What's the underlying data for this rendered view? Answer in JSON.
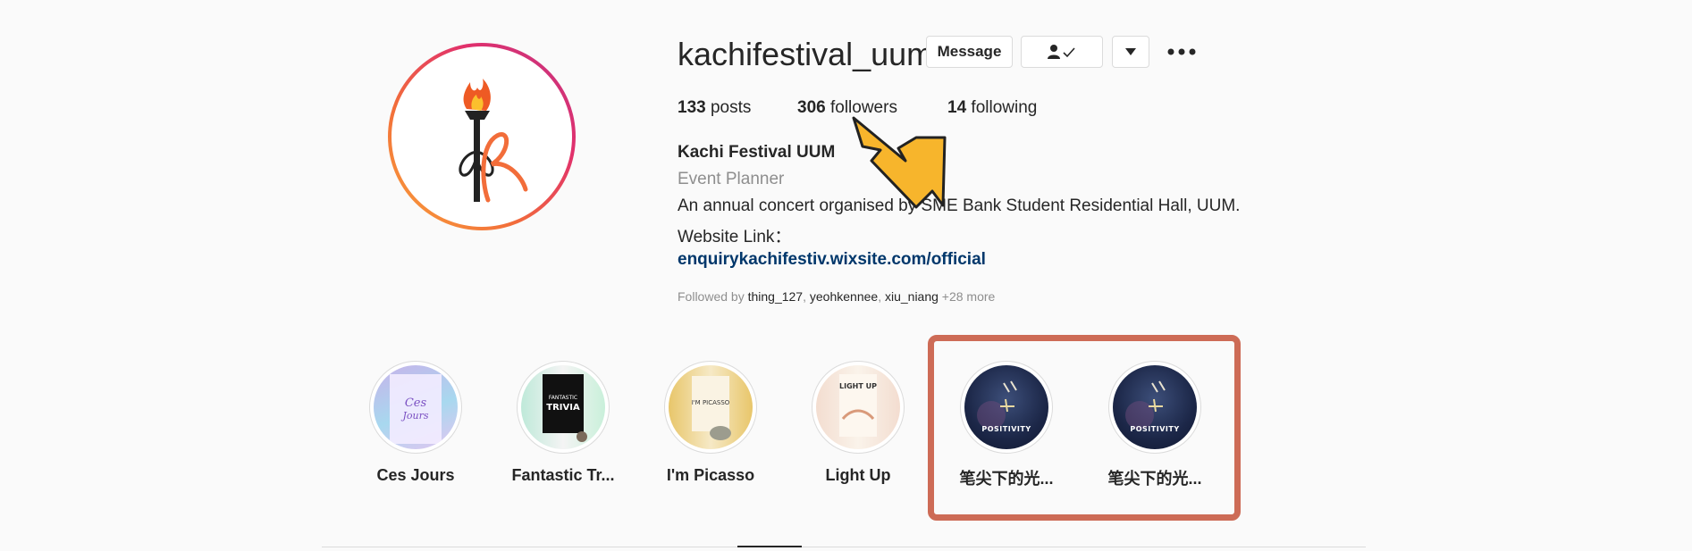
{
  "profile": {
    "username": "kachifestival_uum",
    "buttons": {
      "message": "Message"
    },
    "stats": {
      "posts_count": "133",
      "posts_label": " posts",
      "followers_count": "306",
      "followers_label": " followers",
      "following_count": "14",
      "following_label": " following"
    },
    "bio": {
      "name": "Kachi Festival UUM",
      "category": "Event Planner",
      "description": "An annual concert organised by SME Bank Student Residential Hall, UUM.",
      "website_label": "Website Link：",
      "link": "enquirykachifestiv.wixsite.com/official"
    },
    "followed_by": {
      "prefix": "Followed by ",
      "users": [
        "thing_127",
        "yeohkennee",
        "xiu_niang"
      ],
      "more": " +28 more"
    }
  },
  "highlights": [
    {
      "label": "Ces Jours"
    },
    {
      "label": "Fantastic Tr..."
    },
    {
      "label": "I'm Picasso"
    },
    {
      "label": "Light Up"
    },
    {
      "label": "笔尖下的光..."
    },
    {
      "label": "笔尖下的光..."
    }
  ],
  "colors": {
    "annotation_arrow": "#f7b52c",
    "annotation_box": "#cd6b56",
    "link": "#00376b"
  },
  "icons": {
    "follow_status": "person-check-icon",
    "dropdown": "chevron-down-icon",
    "more": "more-horizontal-icon"
  }
}
